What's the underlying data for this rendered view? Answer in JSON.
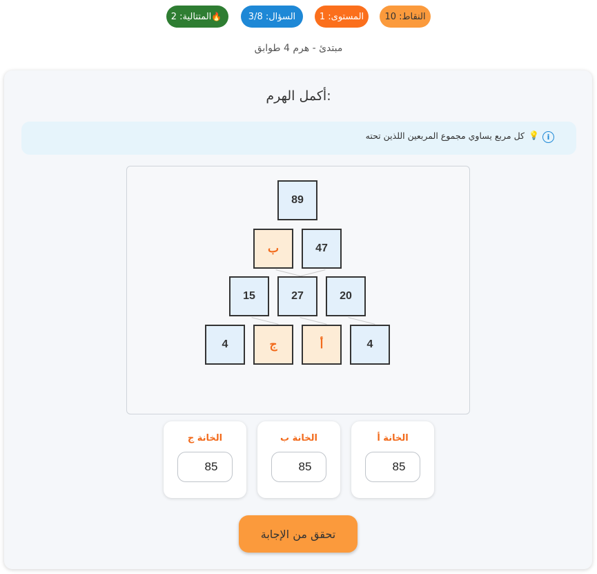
{
  "status": {
    "streak_label": "المتتالية: 2",
    "streak_icon": "fire-icon",
    "question_label": "السؤال: 3/8",
    "level_label": "المستوى: 1",
    "points_label": "النقاط: 10"
  },
  "subtitle": "مبتدئ - هرم 4 طوابق",
  "puzzle": {
    "title": "أكمل الهرم:",
    "hint": "كل مربع يساوي مجموع المربعين اللذين تحته",
    "rows": [
      [
        "89"
      ],
      [
        "ب",
        "47"
      ],
      [
        "15",
        "27",
        "20"
      ],
      [
        "4",
        "ج",
        "أ",
        "4"
      ]
    ]
  },
  "answers": [
    {
      "label": "الخانة أ",
      "value": "85"
    },
    {
      "label": "الخانة ب",
      "value": "85"
    },
    {
      "label": "الخانة ج",
      "value": "85"
    }
  ],
  "check_button": "تحقق من الإجابة",
  "colors": {
    "streak": "#2e7d32",
    "question": "#1e88d6",
    "level": "#fb6f1c",
    "points": "#fb9a3c",
    "unknown_cell": "#fdecd6",
    "known_cell": "#e3f0fb",
    "accent_text": "#f26a1b"
  }
}
